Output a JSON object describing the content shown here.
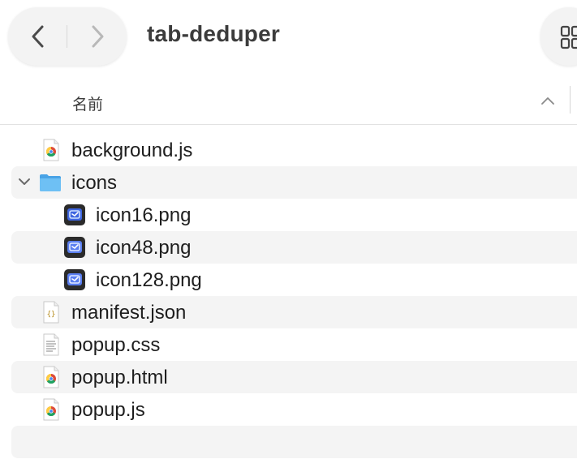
{
  "window": {
    "title": "tab-deduper"
  },
  "toolbar": {
    "back_icon": "chevron-left-icon",
    "forward_icon": "chevron-right-icon",
    "view_icon": "grid-view-icon"
  },
  "columns": {
    "name_header": "名前",
    "sort_icon": "chevron-up-icon"
  },
  "files": [
    {
      "name": "background.js",
      "icon": "chrome-doc-icon",
      "expanded": null
    },
    {
      "name": "icons",
      "icon": "folder-icon",
      "expanded": true
    },
    {
      "name": "icon16.png",
      "icon": "image-icon",
      "expanded": null
    },
    {
      "name": "icon48.png",
      "icon": "image-icon",
      "expanded": null
    },
    {
      "name": "icon128.png",
      "icon": "image-icon",
      "expanded": null
    },
    {
      "name": "manifest.json",
      "icon": "json-doc-icon",
      "expanded": null
    },
    {
      "name": "popup.css",
      "icon": "text-doc-icon",
      "expanded": null
    },
    {
      "name": "popup.html",
      "icon": "chrome-doc-icon",
      "expanded": null
    },
    {
      "name": "popup.js",
      "icon": "chrome-doc-icon",
      "expanded": null
    }
  ],
  "colors": {
    "folder": "#5ab4ef",
    "stripe": "#f4f4f4",
    "title": "#3c3c3c"
  }
}
